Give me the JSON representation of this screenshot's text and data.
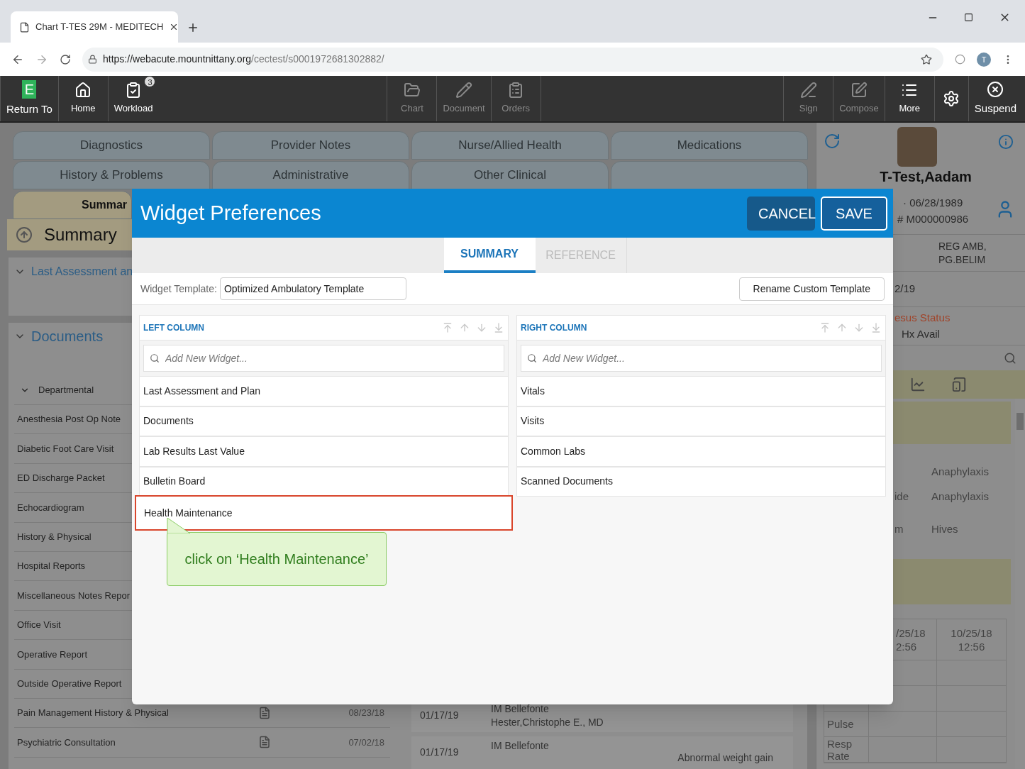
{
  "browser": {
    "tab_title": "Chart T-TES 29M - MEDITECH",
    "url_host": "https://webacute.mountnittany.org",
    "url_path": "/cectest/s0001972681302882/",
    "profile_initial": "T"
  },
  "toolbar": {
    "left": [
      {
        "kind": "return",
        "logo": "E",
        "label": "Return To",
        "disabled": false
      },
      {
        "kind": "home",
        "label": "Home",
        "disabled": false
      },
      {
        "kind": "workload",
        "label": "Workload",
        "badge": "3",
        "disabled": false
      }
    ],
    "center": [
      {
        "kind": "chart",
        "label": "Chart",
        "disabled": true
      },
      {
        "kind": "document",
        "label": "Document",
        "disabled": true
      },
      {
        "kind": "orders",
        "label": "Orders",
        "disabled": true
      }
    ],
    "right": [
      {
        "kind": "sign",
        "label": "Sign",
        "disabled": true
      },
      {
        "kind": "compose",
        "label": "Compose",
        "disabled": true
      },
      {
        "kind": "more",
        "label": "More",
        "disabled": false
      },
      {
        "kind": "settings",
        "disabled": false
      },
      {
        "kind": "suspend",
        "label": "Suspend",
        "disabled": false
      }
    ]
  },
  "chart_tabs": [
    [
      {
        "label": "Diagnostics",
        "selected": false
      },
      {
        "label": "Provider Notes",
        "selected": false
      },
      {
        "label": "Nurse/Allied Health",
        "selected": false
      },
      {
        "label": "Medications",
        "selected": false
      }
    ],
    [
      {
        "label": "History & Problems",
        "selected": false
      },
      {
        "label": "Administrative",
        "selected": false
      },
      {
        "label": "Other Clinical",
        "selected": false
      },
      {
        "selected": false
      }
    ],
    [
      {
        "label": "Summar",
        "selected": true
      }
    ]
  ],
  "summary": {
    "title": "Summary",
    "sections": [
      {
        "title": "Last Assessment an",
        "expanded": true
      },
      {
        "title": "Documents",
        "expanded": true
      }
    ]
  },
  "documents": {
    "group": {
      "label": "Departmental",
      "expanded": true
    },
    "rows": [
      {
        "name": "Anesthesia Post Op Note"
      },
      {
        "name": "Diabetic Foot Care Visit"
      },
      {
        "name": "ED Discharge Packet"
      },
      {
        "name": "Echocardiogram"
      },
      {
        "name": "History & Physical"
      },
      {
        "name": "Hospital Reports"
      },
      {
        "name": "Miscellaneous Notes Repor"
      },
      {
        "name": "Office Visit"
      },
      {
        "name": "Operative Report"
      },
      {
        "name": "Outside Operative Report"
      },
      {
        "name": "Pain Management History & Physical",
        "date": "08/23/18"
      },
      {
        "name": "Psychiatric Consultation",
        "date": "07/02/18"
      }
    ]
  },
  "visits": [
    {
      "date": "01/17/19",
      "location": "IM Bellefonte",
      "provider": "Hester,Christophe E., MD"
    },
    {
      "date": "01/17/19",
      "location": "IM Bellefonte",
      "reason": "Abnormal weight gain"
    }
  ],
  "patient": {
    "name": "T-Test,Aadam",
    "birth": "· 06/28/1989",
    "account": "# M000000986",
    "location": [
      "REG AMB,",
      "PG.BELIM"
    ],
    "date": "2/19",
    "code_status_label": "esus Status",
    "code_status": "Hx Avail",
    "allergies": [
      {
        "reaction": "Anaphylaxis"
      },
      {
        "allergen": "ide",
        "reaction": "Anaphylaxis"
      },
      {
        "allergen": "m",
        "reaction": "Hives"
      }
    ],
    "vitals": {
      "columns": [
        [
          "/25/18",
          "2:56"
        ],
        [
          "10/25/18",
          "12:56"
        ]
      ],
      "rows": [
        "",
        "",
        "Pulse",
        "Resp Rate"
      ]
    }
  },
  "modal": {
    "title": "Widget Preferences",
    "buttons": [
      {
        "kind": "cancel",
        "label": "CANCEL"
      },
      {
        "kind": "save",
        "label": "SAVE"
      }
    ],
    "tabs": [
      {
        "label": "SUMMARY",
        "selected": true
      },
      {
        "label": "REFERENCE",
        "selected": false
      }
    ],
    "template_label": "Widget Template:",
    "template_value": "Optimized Ambulatory Template",
    "rename_button": "Rename Custom Template",
    "columns": [
      {
        "title": "LEFT COLUMN",
        "placeholder": "Add New Widget...",
        "items": [
          {
            "label": "Last Assessment and Plan",
            "highlighted": false
          },
          {
            "label": "Documents",
            "highlighted": false
          },
          {
            "label": "Lab Results Last Value",
            "highlighted": false
          },
          {
            "label": "Bulletin Board",
            "highlighted": false
          },
          {
            "label": "Health Maintenance",
            "highlighted": true
          }
        ]
      },
      {
        "title": "RIGHT COLUMN",
        "placeholder": "Add New Widget...",
        "items": [
          {
            "label": "Vitals",
            "highlighted": false
          },
          {
            "label": "Visits",
            "highlighted": false
          },
          {
            "label": "Common Labs",
            "highlighted": false
          },
          {
            "label": "Scanned Documents",
            "highlighted": false
          }
        ]
      }
    ],
    "callout": "click on ‘Health Maintenance’"
  }
}
